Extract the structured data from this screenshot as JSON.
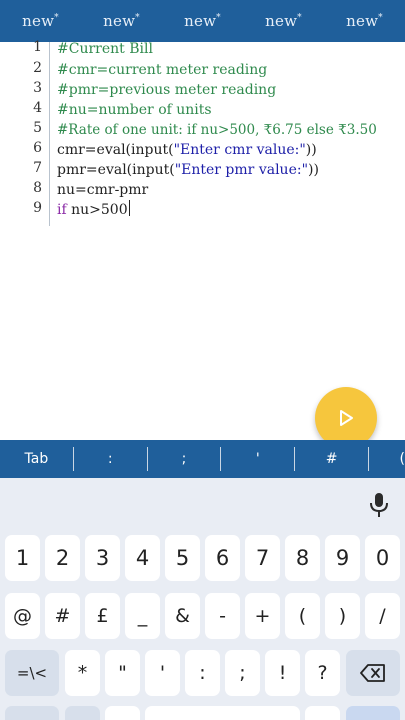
{
  "tabs": [
    {
      "label": "new",
      "mark": "*"
    },
    {
      "label": "new",
      "mark": "*"
    },
    {
      "label": "new",
      "mark": "*"
    },
    {
      "label": "new",
      "mark": "*"
    },
    {
      "label": "new",
      "mark": "*"
    }
  ],
  "editor": {
    "lines": [
      {
        "n": "1",
        "text": "#Current Bill"
      },
      {
        "n": "2",
        "text": "#cmr=current meter reading"
      },
      {
        "n": "3",
        "text": "#pmr=previous meter reading"
      },
      {
        "n": "4",
        "text": "#nu=number of units"
      },
      {
        "n": "5",
        "text": "#Rate of one unit: if nu>500, ₹6.75 else ₹3.50"
      },
      {
        "n": "6",
        "pre": "cmr=eval(input(",
        "str": "\"Enter cmr value:\"",
        "post": "))"
      },
      {
        "n": "7",
        "pre": "pmr=eval(input(",
        "str": "\"Enter pmr value:\"",
        "post": "))"
      },
      {
        "n": "8",
        "text": "nu=cmr-pmr"
      },
      {
        "n": "9",
        "kw": "if",
        "text": " nu>500"
      }
    ]
  },
  "symbols": [
    "Tab",
    ":",
    ";",
    "'",
    "#",
    "("
  ],
  "keyboard": {
    "row1": [
      "1",
      "2",
      "3",
      "4",
      "5",
      "6",
      "7",
      "8",
      "9",
      "0"
    ],
    "row2": [
      "@",
      "#",
      "£",
      "_",
      "&",
      "-",
      "+",
      "(",
      ")",
      "/"
    ],
    "row3": [
      "=\\<",
      "*",
      "\"",
      "'",
      ":",
      ";",
      "!",
      "?"
    ]
  },
  "colors": {
    "bar": "#1f5f9b",
    "fab": "#f6c63d",
    "comment": "#2f8a4d",
    "string": "#1d1fa8",
    "keyword": "#8a2aa6"
  }
}
